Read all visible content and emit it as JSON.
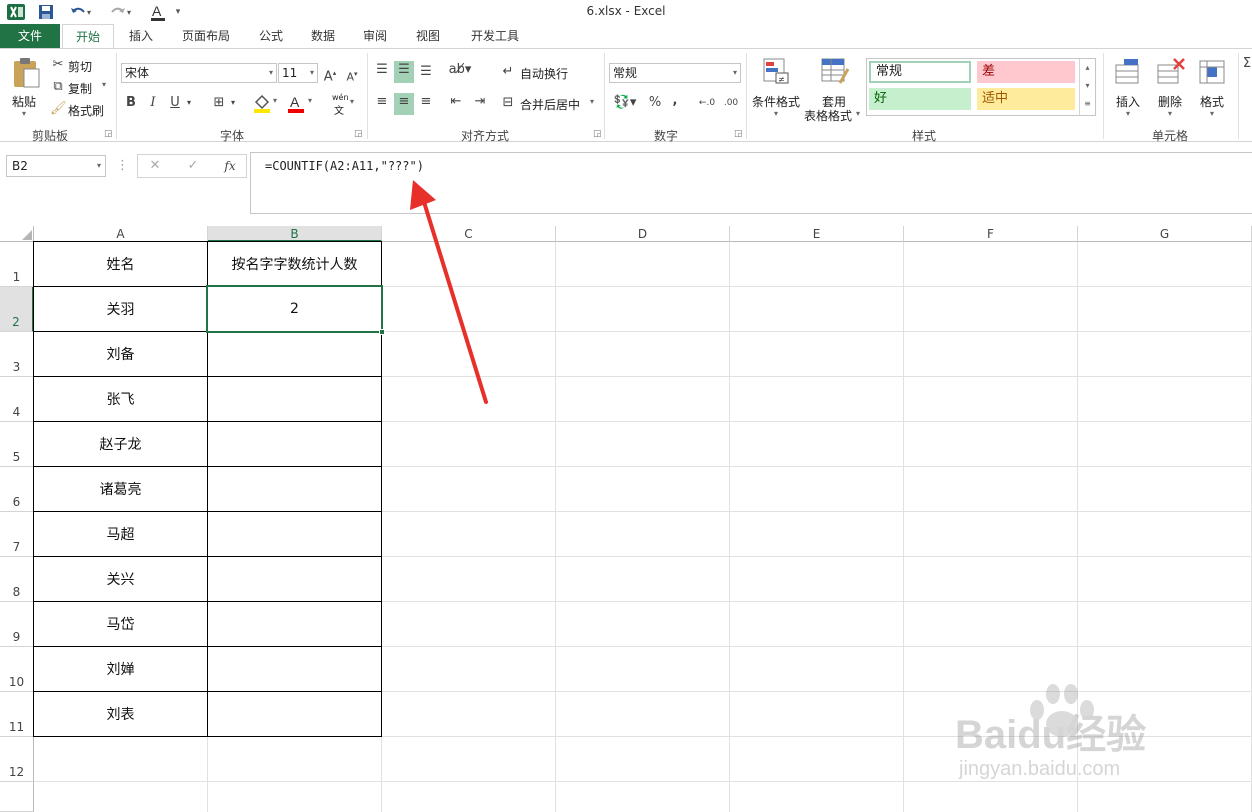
{
  "title": "6.xlsx - Excel",
  "quick_access": {
    "excel_icon": "excel-icon",
    "save_icon": "save-icon",
    "undo_icon": "undo-icon",
    "redo_icon": "redo-icon",
    "font_color_icon": "font-color-icon"
  },
  "tabs": [
    "文件",
    "开始",
    "插入",
    "页面布局",
    "公式",
    "数据",
    "审阅",
    "视图",
    "开发工具"
  ],
  "ribbon": {
    "clipboard": {
      "paste": "粘贴",
      "cut": "剪切",
      "copy": "复制",
      "format_painter": "格式刷",
      "label": "剪贴板"
    },
    "font": {
      "font_name": "宋体",
      "font_size": "11",
      "bold": "B",
      "italic": "I",
      "underline": "U",
      "wen": "wén",
      "label": "字体"
    },
    "alignment": {
      "wrap_text": "自动换行",
      "merge_center": "合并后居中",
      "label": "对齐方式"
    },
    "number": {
      "format": "常规",
      "percent": "%",
      "comma": ",",
      "label": "数字"
    },
    "styles": {
      "conditional_format": "条件格式",
      "format_as_table_1": "套用",
      "format_as_table_2": "表格格式",
      "normal": "常规",
      "bad": "差",
      "good": "好",
      "neutral": "适中",
      "label": "样式"
    },
    "cells": {
      "insert": "插入",
      "delete": "删除",
      "format": "格式",
      "label": "单元格"
    }
  },
  "formula_bar": {
    "name_box": "B2",
    "fx": "fx",
    "formula": "=COUNTIF(A2:A11,\"???\")"
  },
  "columns": [
    "A",
    "B",
    "C",
    "D",
    "E",
    "F",
    "G"
  ],
  "rows": [
    "1",
    "2",
    "3",
    "4",
    "5",
    "6",
    "7",
    "8",
    "9",
    "10",
    "11",
    "12"
  ],
  "cells": {
    "A": [
      "姓名",
      "关羽",
      "刘备",
      "张飞",
      "赵子龙",
      "诸葛亮",
      "马超",
      "关兴",
      "马岱",
      "刘婵",
      "刘表"
    ],
    "B": [
      "按名字字数统计人数",
      "2"
    ]
  },
  "watermark": {
    "brand": "Baidu经验",
    "url": "jingyan.baidu.com"
  },
  "colors": {
    "excel_green": "#217346",
    "annotation_red": "#e8302a"
  }
}
